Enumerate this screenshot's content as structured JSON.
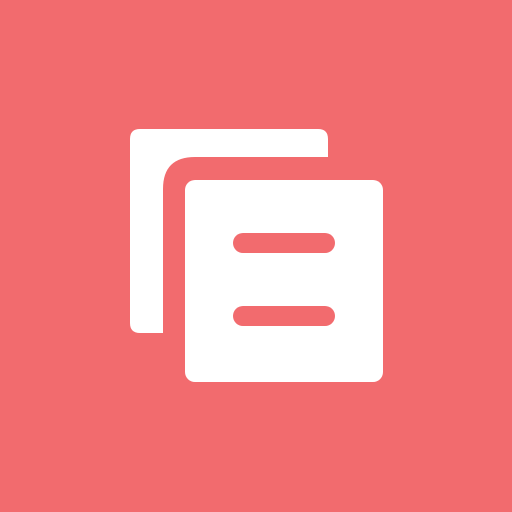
{
  "icon": {
    "name": "copy-documents-icon",
    "background_color": "#F26B6E",
    "foreground_color": "#FFFFFF"
  }
}
